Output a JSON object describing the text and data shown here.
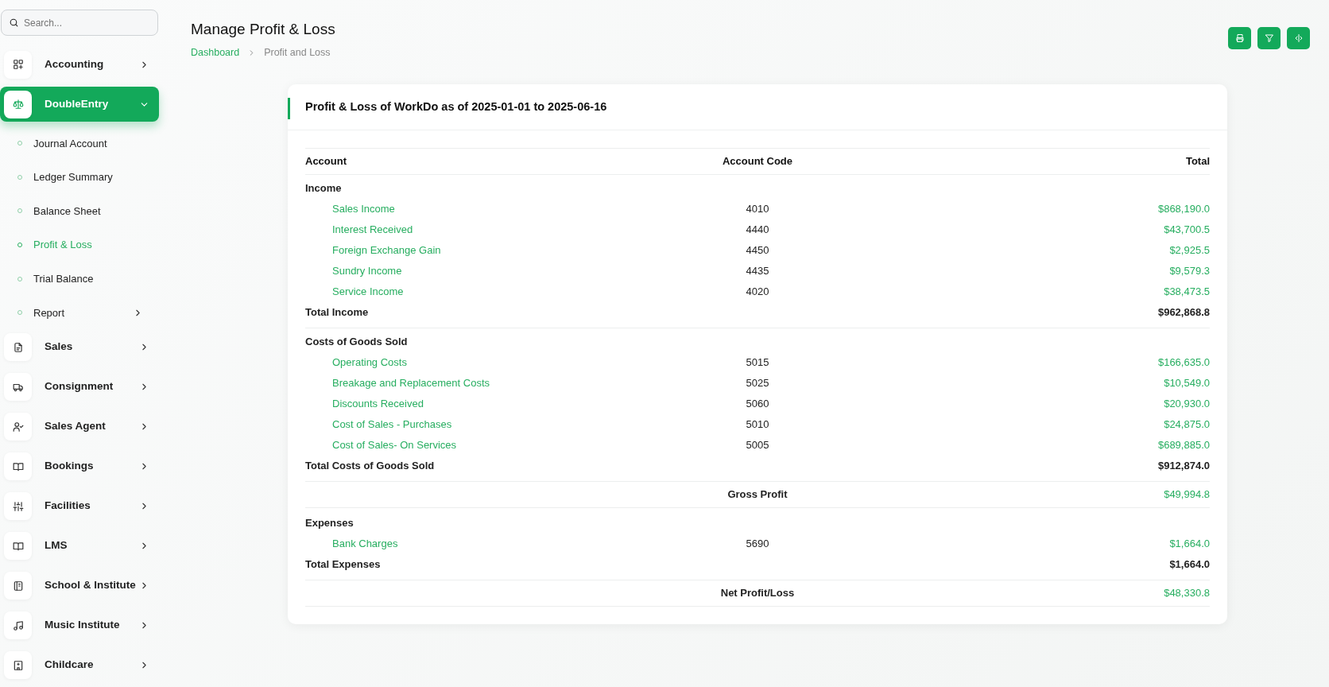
{
  "sidebar": {
    "search": {
      "placeholder": "Search..."
    },
    "items": [
      {
        "label": "Accounting",
        "selected": false,
        "expanded": false
      },
      {
        "label": "DoubleEntry",
        "selected": true,
        "expanded": true,
        "children": [
          {
            "label": "Journal Account",
            "selected": false,
            "has_submenu": false
          },
          {
            "label": "Ledger Summary",
            "selected": false,
            "has_submenu": false
          },
          {
            "label": "Balance Sheet",
            "selected": false,
            "has_submenu": false
          },
          {
            "label": "Profit & Loss",
            "selected": true,
            "has_submenu": false
          },
          {
            "label": "Trial Balance",
            "selected": false,
            "has_submenu": false
          },
          {
            "label": "Report",
            "selected": false,
            "has_submenu": true
          }
        ]
      },
      {
        "label": "Sales",
        "selected": false,
        "expanded": false
      },
      {
        "label": "Consignment",
        "selected": false,
        "expanded": false
      },
      {
        "label": "Sales Agent",
        "selected": false,
        "expanded": false
      },
      {
        "label": "Bookings",
        "selected": false,
        "expanded": false
      },
      {
        "label": "Facilities",
        "selected": false,
        "expanded": false
      },
      {
        "label": "LMS",
        "selected": false,
        "expanded": false
      },
      {
        "label": "School & Institute",
        "selected": false,
        "expanded": false
      },
      {
        "label": "Music Institute",
        "selected": false,
        "expanded": false
      },
      {
        "label": "Childcare",
        "selected": false,
        "expanded": false
      }
    ]
  },
  "header": {
    "title": "Manage Profit & Loss",
    "breadcrumb": [
      "Dashboard",
      "Profit and Loss"
    ]
  },
  "report": {
    "title": "Profit & Loss of WorkDo as of 2025-01-01 to 2025-06-16",
    "columns": [
      "Account",
      "Account Code",
      "Total"
    ],
    "rows": [
      {
        "kind": "section",
        "label": "Income"
      },
      {
        "kind": "account",
        "account": "Sales Income",
        "code": "4010",
        "total": "$868,190.0"
      },
      {
        "kind": "account",
        "account": "Interest Received",
        "code": "4440",
        "total": "$43,700.5"
      },
      {
        "kind": "account",
        "account": "Foreign Exchange Gain",
        "code": "4450",
        "total": "$2,925.5"
      },
      {
        "kind": "account",
        "account": "Sundry Income",
        "code": "4435",
        "total": "$9,579.3"
      },
      {
        "kind": "account",
        "account": "Service Income",
        "code": "4020",
        "total": "$38,473.5"
      },
      {
        "kind": "total",
        "label": "Total Income",
        "total": "$962,868.8"
      },
      {
        "kind": "section",
        "label": "Costs of Goods Sold"
      },
      {
        "kind": "account",
        "account": "Operating Costs",
        "code": "5015",
        "total": "$166,635.0"
      },
      {
        "kind": "account",
        "account": "Breakage and Replacement Costs",
        "code": "5025",
        "total": "$10,549.0"
      },
      {
        "kind": "account",
        "account": "Discounts Received",
        "code": "5060",
        "total": "$20,930.0"
      },
      {
        "kind": "account",
        "account": "Cost of Sales - Purchases",
        "code": "5010",
        "total": "$24,875.0"
      },
      {
        "kind": "account",
        "account": "Cost of Sales- On Services",
        "code": "5005",
        "total": "$689,885.0"
      },
      {
        "kind": "total",
        "label": "Total Costs of Goods Sold",
        "total": "$912,874.0"
      },
      {
        "kind": "summary",
        "label": "Gross Profit",
        "total": "$49,994.8"
      },
      {
        "kind": "section",
        "label": "Expenses"
      },
      {
        "kind": "account",
        "account": "Bank Charges",
        "code": "5690",
        "total": "$1,664.0"
      },
      {
        "kind": "total",
        "label": "Total Expenses",
        "total": "$1,664.0"
      },
      {
        "kind": "summary",
        "label": "Net Profit/Loss",
        "total": "$48,330.8"
      }
    ]
  }
}
